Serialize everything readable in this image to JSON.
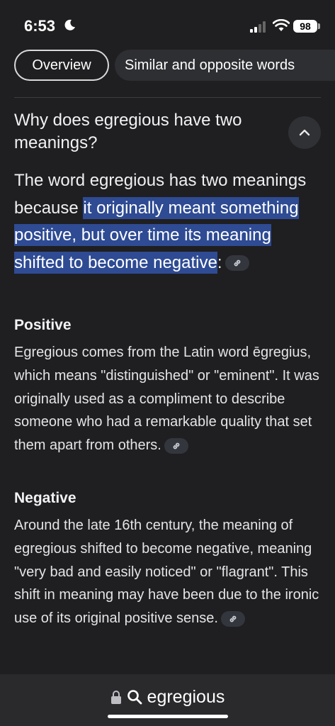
{
  "status": {
    "time": "6:53",
    "battery": "98"
  },
  "tabs": [
    {
      "label": "Overview",
      "active": true
    },
    {
      "label": "Similar and opposite words",
      "active": false
    }
  ],
  "section": {
    "title": "Why does egregious have two meanings?",
    "answer_prefix": "The word egregious has two meanings because ",
    "answer_highlight": "it originally meant something positive, but over time its meaning shifted to become negative",
    "answer_suffix": ":"
  },
  "positive": {
    "heading": "Positive",
    "text": "Egregious comes from the Latin word ēgregius, which means \"distinguished\" or \"eminent\". It was originally used as a compliment to describe someone who had a remarkable quality that set them apart from others."
  },
  "negative": {
    "heading": "Negative",
    "text": "Around the late 16th century, the meaning of egregious shifted to become negative, meaning \"very bad and easily noticed\" or \"flagrant\". This shift in meaning may have been due to the ironic use of its original positive sense."
  },
  "address_bar": {
    "query": "egregious"
  },
  "colors": {
    "background": "#1f1f21",
    "highlight": "#2e4b93",
    "chip": "#34363e"
  },
  "icons": [
    "moon-icon",
    "signal-icon",
    "wifi-icon",
    "chevron-up-icon",
    "link-icon",
    "lock-icon",
    "search-icon"
  ]
}
